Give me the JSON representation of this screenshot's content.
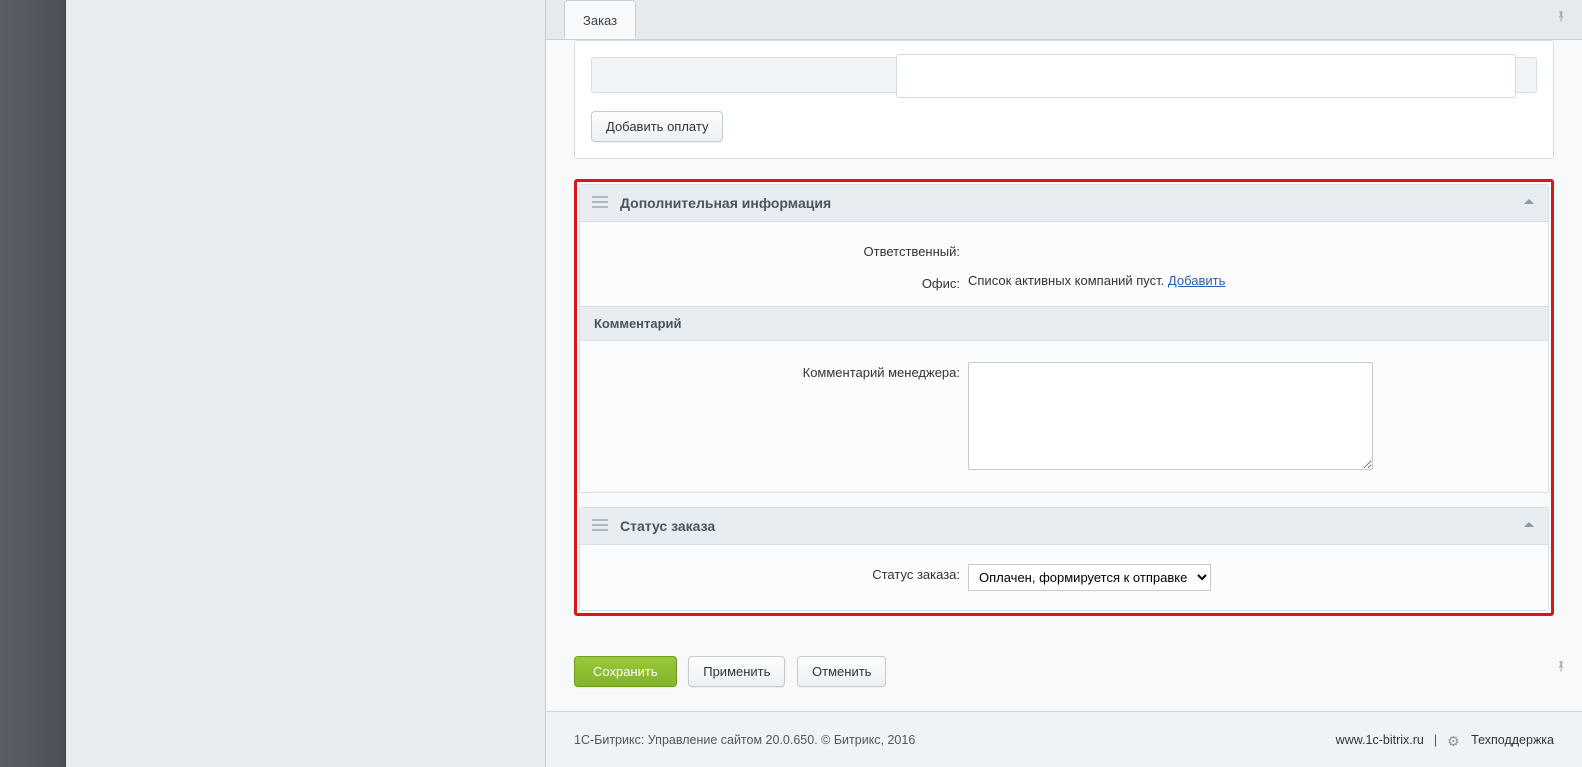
{
  "tab": {
    "label": "Заказ"
  },
  "payment_section": {
    "add_payment_label": "Добавить оплату"
  },
  "additional_info": {
    "title": "Дополнительная информация",
    "responsible_label": "Ответственный:",
    "responsible_value": "",
    "office_label": "Офис:",
    "office_empty_text": "Список активных компаний пуст.",
    "office_add_link": "Добавить",
    "comment_subhead": "Комментарий",
    "manager_comment_label": "Комментарий менеджера:",
    "manager_comment_value": ""
  },
  "order_status": {
    "title": "Статус заказа",
    "label": "Статус заказа:",
    "selected": "Оплачен, формируется к отправке"
  },
  "actions": {
    "save": "Сохранить",
    "apply": "Применить",
    "cancel": "Отменить"
  },
  "footer": {
    "left": "1С-Битрикс: Управление сайтом 20.0.650. © Битрикс, 2016",
    "site_link": "www.1c-bitrix.ru",
    "separator": "|",
    "support": "Техподдержка"
  }
}
